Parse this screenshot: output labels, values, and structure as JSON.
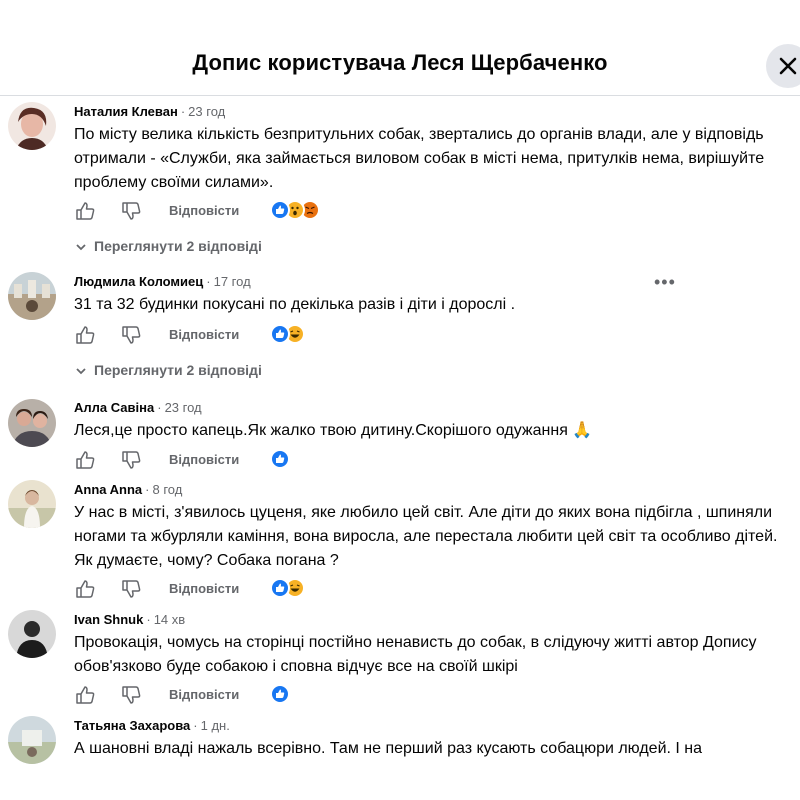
{
  "header": {
    "title": "Допис користувача Леся Щербаченко",
    "close_icon": "close-icon"
  },
  "reply_label": "Відповісти",
  "separator": "·",
  "colors": {
    "text": "#050505",
    "muted": "#65676b",
    "like": "#1877f2",
    "close_bg": "#e4e6eb"
  },
  "comments": [
    {
      "name": "Наталия Клеван",
      "time": "23 год",
      "text": "По місту велика кількість безпритульних собак, звертались до органів влади, але у відповідь отримали - «Служби, яка займається виловом собак в місті нема, притулків нема, вирішуйте проблему своїми силами».",
      "reactions": [
        "like",
        "wow",
        "angry"
      ],
      "view_replies": "Переглянути 2 відповіді"
    },
    {
      "name": "Людмила Коломиец",
      "time": "17 год",
      "text": "31 та 32 будинки покусані по декілька разів і діти і дорослі .",
      "more_icon": "more-options-icon",
      "reactions": [
        "like",
        "haha"
      ],
      "view_replies": "Переглянути 2 відповіді"
    },
    {
      "name": "Алла Савіна",
      "time": "23 год",
      "text": "Леся,це просто капець.Як жалко твою дитину.Скорішого одужання 🙏",
      "reactions": [
        "like"
      ]
    },
    {
      "name": "Anna Anna",
      "time": "8 год",
      "text": "У нас в місті, з'явилось цуценя, яке любило цей світ. Але діти до яких вона підбігла , шпиняли ногами та жбурляли каміння, вона виросла, але перестала любити цей світ та особливо дітей. Як думаєте, чому? Собака погана ?",
      "reactions": [
        "like",
        "haha"
      ]
    },
    {
      "name": "Ivan Shnuk",
      "time": "14 хв",
      "text": "Провокація, чомусь на сторінці постійно ненависть до собак, в слідуючу житті автор Допису обов'язково буде собакою і сповна відчує все на своїй шкірі",
      "reactions": [
        "like"
      ]
    },
    {
      "name": "Татьяна Захарова",
      "time": "1 дн.",
      "text": "А шановні владі нажаль всерівно. Там не перший раз кусають собацюри людей. І на"
    }
  ]
}
